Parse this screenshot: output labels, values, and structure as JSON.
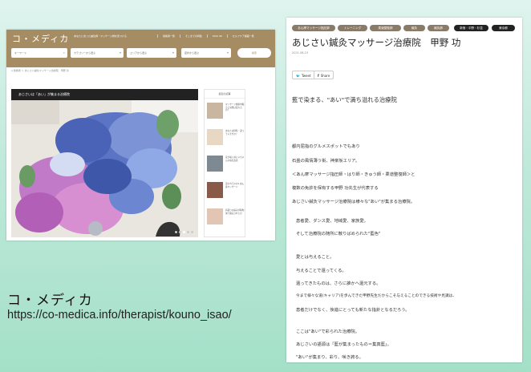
{
  "left_screenshot": {
    "logo": "コ・メディカ",
    "tagline": "あなたに合った鍼灸師・マッサージ師を見つける",
    "nav": [
      "施術者一覧",
      "そこまでの特集",
      "PICK UP",
      "セルフケア講座一覧"
    ],
    "search": {
      "keyword_placeholder": "キーワード",
      "category_placeholder": "カテゴリーから選ぶ",
      "area_placeholder": "エリアから選ぶ",
      "symptom_placeholder": "症状から選ぶ",
      "search_label": "検索"
    },
    "breadcrumb": "⌂  施術者 ＞ あじさい鍼灸マッサージ治療院　甲野 功",
    "article_bar": "あじさいは「あい」が集まる治療院",
    "sidebar": {
      "title": "最近の記事",
      "items": [
        "マッサージ施術中眠ると効果は変わるの？",
        "あなたは仰臥・違っていますか？",
        "花が咲く前にいちゃんの病気改善",
        "温まれてのの2 あん摩マッサージ",
        "肩凝りの痛みが稼動域で確実されたか"
      ]
    }
  },
  "caption": {
    "title": "コ・メディカ",
    "url": "https://co-medica.info/therapist/kouno_isao/"
  },
  "right_screenshot": {
    "category_tags": [
      "あん摩マッサージ指圧師",
      "トレーニング",
      "柔道整復師",
      "鍼灸",
      "鍼灸師"
    ],
    "area_tags": [
      "新宿・中野・杉並",
      "東京都"
    ],
    "title": "あじさい鍼灸マッサージ治療院　甲野 功",
    "date": "2021.08.23",
    "share_buttons": [
      "Tweet",
      "Share"
    ],
    "lead": "藍で染まる、\"あい\"で満ち溢れる治療院",
    "paragraphs": [
      "都内屈指のグルメスポットでもあり",
      "石畳の風情薄う街、神楽坂エリア。",
      "＜あん摩マッサージ指圧師・はり師・きゅう師・柔道整復師＞と",
      "複数の免許を保有する甲野 功先生が代表する",
      "あじさい鍼灸マッサージ治療院は様々な\"あい\"が集まる治療院。",
      "患者愛、ダンス愛、地域愛、家族愛。",
      "そして治療院の随所に散りばめられた\"藍色\"",
      "愛とは与えること。",
      "与えることで還ってくる。",
      "還ってきたものは、さらに誰かへ還元する。",
      "今まで様々な道(キャリア)を歩んできた甲野先生だからこそ与えることのできる技術や見識は、",
      "患者だけでなく、後進にとっても新たな指針となるだろう。",
      "ここは\"あい\"で彩られた治療院。",
      "あじさいの語源は「藍が集まったもの＝集真藍」。",
      "\"あい\"が集まり、彩り、咲き誇る。"
    ]
  },
  "colors": {
    "header_brown": "#a58c63",
    "category_tag": "#8a7b68",
    "area_tag": "#222222",
    "background_top": "#dff4ee",
    "background_bottom": "#a4e0c8"
  }
}
